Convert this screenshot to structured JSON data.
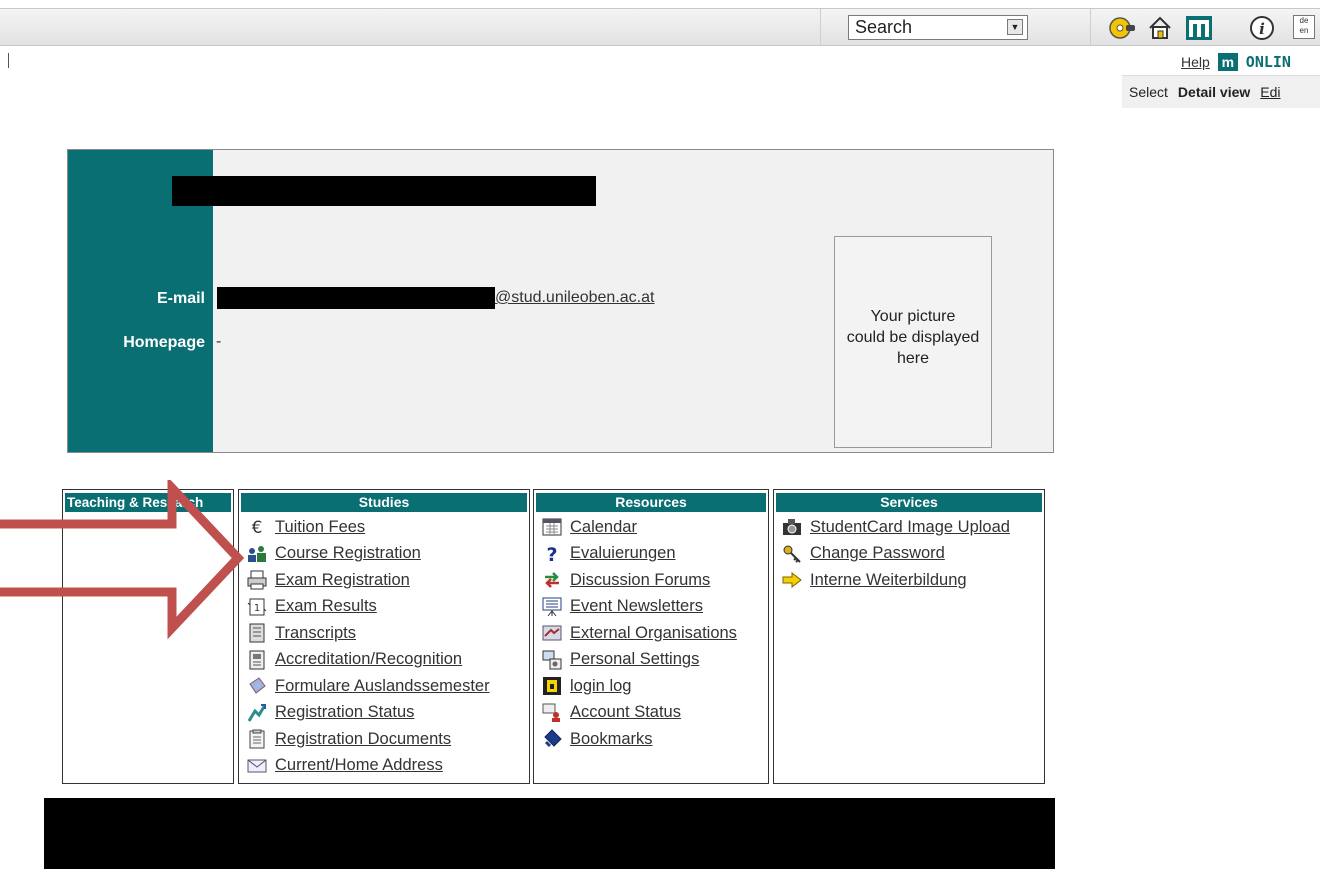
{
  "toolbar": {
    "search_label": "Search",
    "lang_label": "de en",
    "icons": [
      "cd-key-icon",
      "home-icon",
      "m-logo-icon",
      "info-icon"
    ]
  },
  "toplinks": {
    "help": "Help",
    "brand_m": "m",
    "brand_online": "ONLIN"
  },
  "tabs": {
    "select": "Select",
    "detail": "Detail view",
    "edit": "Edi"
  },
  "profile": {
    "email_label": "E-mail",
    "email_domain": "@stud.unileoben.ac.at",
    "homepage_label": "Homepage",
    "homepage_value": "-",
    "picture_text": "Your picture\ncould be displayed\nhere"
  },
  "sections": {
    "teaching": {
      "title": "Teaching & Research"
    },
    "studies": {
      "title": "Studies",
      "items": [
        {
          "label": "Tuition Fees",
          "icon": "euro-icon"
        },
        {
          "label": "Course Registration",
          "icon": "people-icon"
        },
        {
          "label": "Exam Registration",
          "icon": "printer-icon"
        },
        {
          "label": "Exam Results",
          "icon": "results-icon"
        },
        {
          "label": "Transcripts",
          "icon": "transcript-icon"
        },
        {
          "label": "Accreditation/Recognition",
          "icon": "document-icon"
        },
        {
          "label": "Formulare Auslandssemester",
          "icon": "globe-icon"
        },
        {
          "label": "Registration Status",
          "icon": "status-icon"
        },
        {
          "label": "Registration Documents",
          "icon": "documents-icon"
        },
        {
          "label": "Current/Home Address",
          "icon": "address-icon"
        }
      ]
    },
    "resources": {
      "title": "Resources",
      "items": [
        {
          "label": "Calendar",
          "icon": "calendar-icon"
        },
        {
          "label": "Evaluierungen",
          "icon": "question-icon"
        },
        {
          "label": "Discussion Forums",
          "icon": "arrows-icon"
        },
        {
          "label": "Event Newsletters",
          "icon": "newsletter-icon"
        },
        {
          "label": "External Organisations",
          "icon": "handshake-icon"
        },
        {
          "label": "Personal Settings",
          "icon": "settings-icon"
        },
        {
          "label": "login log",
          "icon": "lock-icon"
        },
        {
          "label": "Account Status",
          "icon": "account-icon"
        },
        {
          "label": "Bookmarks",
          "icon": "bookmark-icon"
        }
      ]
    },
    "services": {
      "title": "Services",
      "items": [
        {
          "label": "StudentCard Image Upload",
          "icon": "camera-icon"
        },
        {
          "label": "Change Password",
          "icon": "key-icon"
        },
        {
          "label": "Interne Weiterbildung",
          "icon": "arrow-right-icon"
        }
      ]
    }
  },
  "colors": {
    "teal": "#0a6f73",
    "annotation_arrow": "#c0504d"
  }
}
